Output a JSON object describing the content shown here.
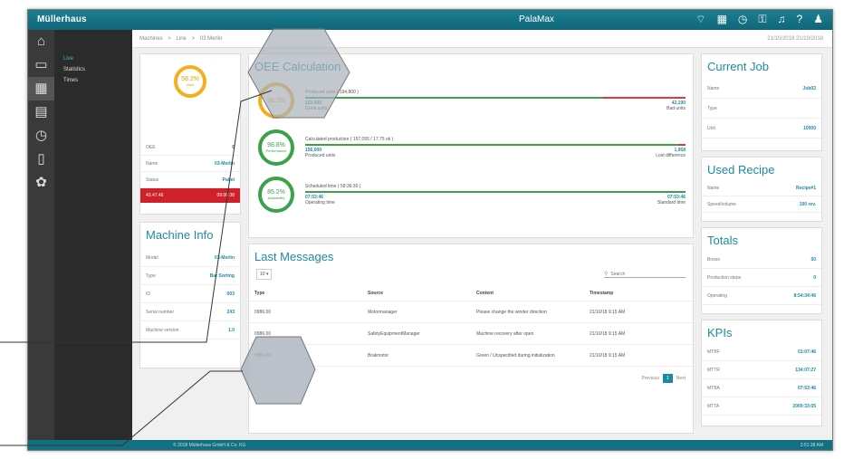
{
  "topbar": {
    "brand": "Müllerhaus",
    "app": "PalaMax",
    "icons": [
      "wifi-icon",
      "grid-icon",
      "clock-icon",
      "key-icon",
      "bell-icon",
      "help-icon",
      "user-icon"
    ]
  },
  "subnav": {
    "items": [
      "Live",
      "Statistics",
      "Times"
    ]
  },
  "breadcrumb": {
    "items": [
      "Machines",
      ">",
      "Line",
      ">",
      "03 Merlin"
    ],
    "datetime": "21/10/2018  21/10/2018"
  },
  "overview": {
    "ring_value": "58.2%",
    "ring_unit": "total",
    "rows": [
      {
        "k": "OEE",
        "v": "0"
      },
      {
        "k": "Name",
        "v": "03-Merlin"
      },
      {
        "k": "Status",
        "v": "Pallet"
      }
    ],
    "alert_left": "43.47.46",
    "alert_right": "09:00:38"
  },
  "machine": {
    "title": "Machine Info",
    "rows": [
      {
        "k": "Model",
        "v": "03-Merlin"
      },
      {
        "k": "Type",
        "v": "Bar Sorting"
      },
      {
        "k": "ID",
        "v": "003"
      },
      {
        "k": "Serial number",
        "v": "243"
      },
      {
        "k": "Machine version",
        "v": "1.0"
      }
    ]
  },
  "oee": {
    "title": "OEE Calculation",
    "items": [
      {
        "ring": "58.2%",
        "ring_sub": "",
        "head": "Produced units ( 194,800 )",
        "left_val": "153,000",
        "left_lbl": "Good units",
        "right_val": "42,190",
        "right_lbl": "Bad units",
        "fill": 78,
        "color": "yellow"
      },
      {
        "ring": "98.8%",
        "ring_sub": "Performance",
        "head": "Calculated production ( 157,055 / 17.75 ok )",
        "left_val": "156,000",
        "left_lbl": "Produced units",
        "right_val": "1,958",
        "right_lbl": "Lost difference",
        "fill": 98,
        "color": "green"
      },
      {
        "ring": "85.2%",
        "ring_sub": "Availability",
        "head": "Scheduled time ( 58:36:30 )",
        "left_val": "07:53:46",
        "left_lbl": "Operating time",
        "right_val": "07:53:46",
        "right_lbl": "Standard time",
        "fill": 100,
        "color": "green"
      }
    ]
  },
  "messages": {
    "title": "Last Messages",
    "page_size": "10",
    "search_placeholder": "Search",
    "headers": [
      "Type",
      "Source",
      "Content",
      "Timestamp"
    ],
    "rows": [
      {
        "type": "0986.00",
        "source": "Motormanager",
        "content": "Please change the winder direction",
        "time": "21/10/18 9:15 AM"
      },
      {
        "type": "0986.00",
        "source": "SafetyEquipmentManager",
        "content": "Machine recovery after open",
        "time": "21/10/18 9:15 AM"
      },
      {
        "type": "0986.00",
        "source": "Brakmotor",
        "content": "Green / Unspecified during initialization",
        "time": "21/10/18 9:15 AM"
      }
    ],
    "pager": {
      "prev": "Previous",
      "page": "1",
      "next": "Next"
    }
  },
  "job": {
    "title": "Current Job",
    "rows": [
      {
        "k": "Name",
        "v": "Job02"
      },
      {
        "k": "Type",
        "v": ""
      },
      {
        "k": "Unit",
        "v": "10000"
      }
    ]
  },
  "recipe": {
    "title": "Used Recipe",
    "rows": [
      {
        "k": "Name",
        "v": "Recipe#1"
      },
      {
        "k": "Speed/volume",
        "v": "100 rev."
      }
    ]
  },
  "totals": {
    "title": "Totals",
    "rows": [
      {
        "k": "Boxes",
        "v": "50"
      },
      {
        "k": "Production steps",
        "v": "0"
      },
      {
        "k": "Operating",
        "v": "8:54:34:46"
      }
    ]
  },
  "kpis": {
    "title": "KPIs",
    "rows": [
      {
        "k": "MTBF",
        "v": "01:07:46"
      },
      {
        "k": "MTTR",
        "v": "134:07:27"
      },
      {
        "k": "MTBA",
        "v": "07:53:46"
      },
      {
        "k": "MTTA",
        "v": "2000:33:05"
      }
    ]
  },
  "footer": {
    "copyright": "© 2018 Müllerhaus GmbH & Co. KG",
    "time": "3:51:38 AM"
  }
}
